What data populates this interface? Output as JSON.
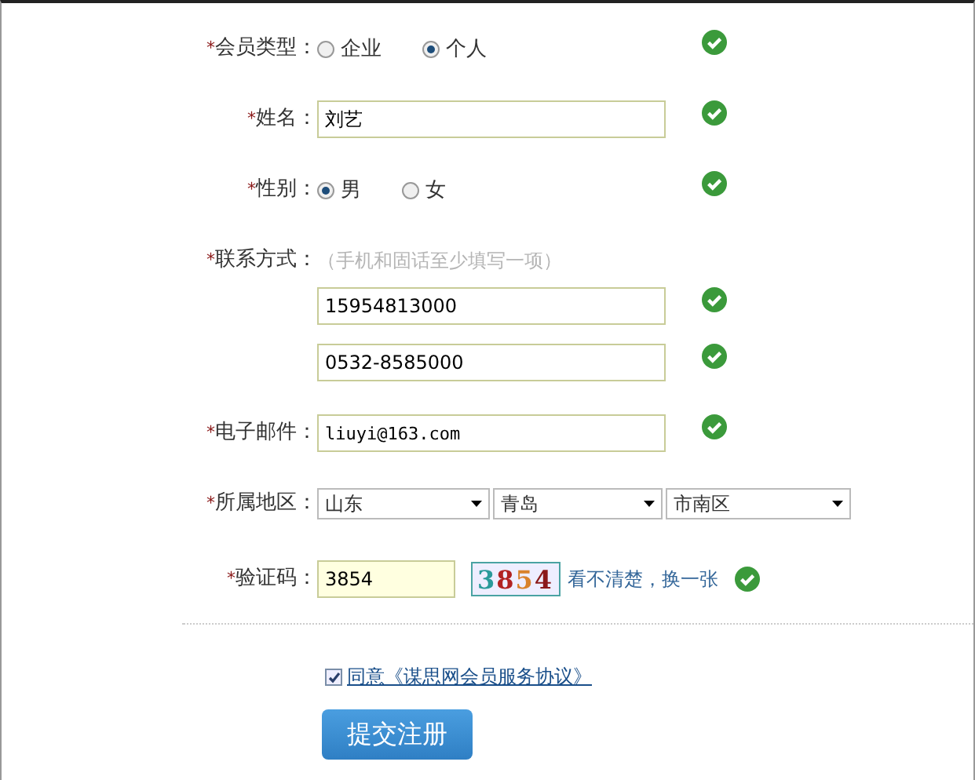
{
  "fields": [
    {
      "kind": "radio",
      "marker": "*",
      "label": "会员类型：",
      "valid": true,
      "options": [
        {
          "label": "企业",
          "selected": false
        },
        {
          "label": "个人",
          "selected": true
        }
      ]
    },
    {
      "kind": "text",
      "marker": "*",
      "label": "姓名：",
      "value": "刘艺",
      "valid": true
    },
    {
      "kind": "radio",
      "marker": "*",
      "label": "性别：",
      "valid": true,
      "options": [
        {
          "label": "男",
          "selected": true
        },
        {
          "label": "女",
          "selected": false
        }
      ]
    },
    {
      "kind": "multi",
      "marker": "*",
      "label": "联系方式：",
      "hint": "（手机和固话至少填写一项）",
      "inputs": [
        {
          "value": "15954813000",
          "valid": true
        },
        {
          "value": "0532-8585000",
          "valid": true
        }
      ]
    },
    {
      "kind": "text",
      "marker": "*",
      "label": "电子邮件：",
      "value": "liuyi@163.com",
      "mono": true,
      "valid": true
    },
    {
      "kind": "selects",
      "marker": "*",
      "label": "所属地区：",
      "selects": [
        "山东",
        "青岛",
        "市南区"
      ]
    },
    {
      "kind": "captcha",
      "marker": "*",
      "label": "验证码：",
      "value": "3854",
      "image_text": "3854",
      "refresh": "看不清楚，换一张",
      "valid": true
    }
  ],
  "agreement": {
    "checked": true,
    "text": "同意《谋思网会员服务协议》"
  },
  "submit": "提交注册"
}
